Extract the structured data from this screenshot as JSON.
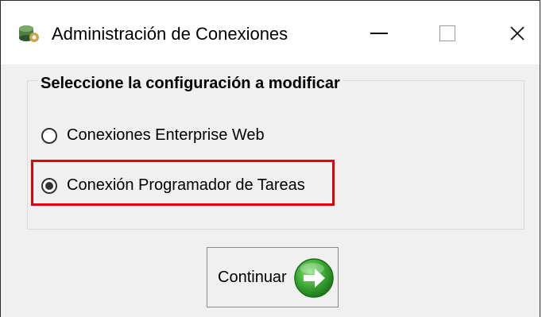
{
  "window": {
    "title": "Administración de Conexiones",
    "icon": "database-gear-icon",
    "controls": {
      "minimize": "minimize-icon",
      "maximize": "maximize-icon",
      "close_label": "✕"
    }
  },
  "group": {
    "title": "Seleccione la configuración a modificar",
    "options": [
      {
        "label": "Conexiones Enterprise Web",
        "checked": false
      },
      {
        "label": "Conexión Programador de Tareas",
        "checked": true
      }
    ]
  },
  "highlight_color": "#e0000e",
  "continue_button": {
    "label": "Continuar",
    "icon": "arrow-right-icon",
    "icon_color": "#2f9a2a"
  }
}
